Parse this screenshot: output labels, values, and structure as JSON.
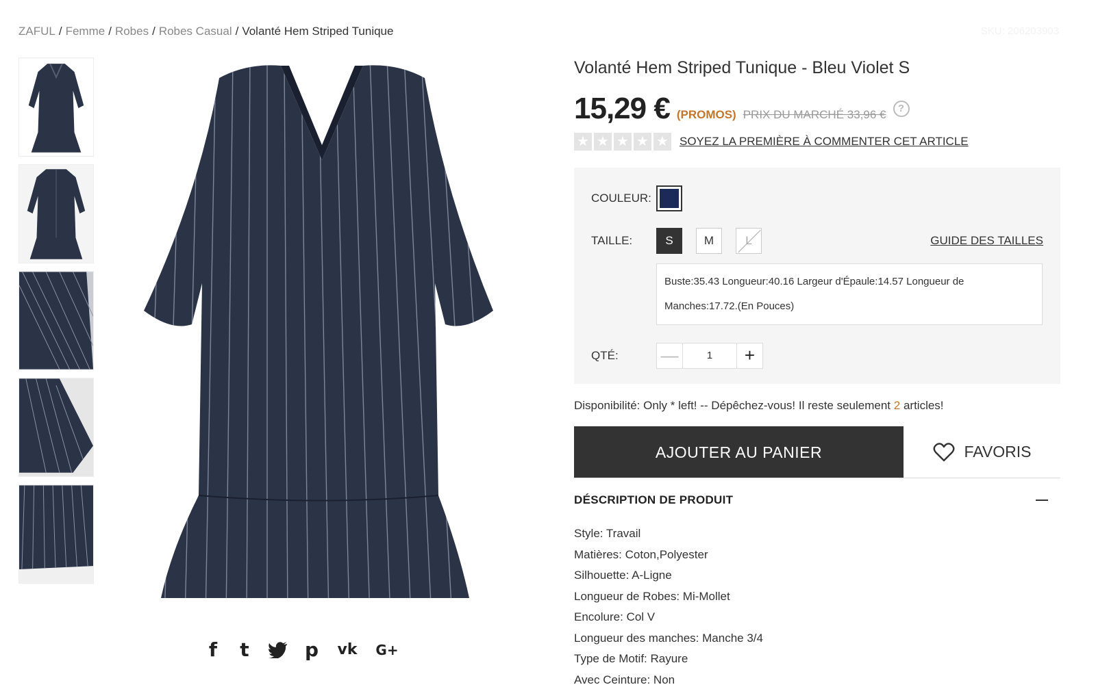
{
  "breadcrumb": {
    "items": [
      "ZAFUL",
      "Femme",
      "Robes",
      "Robes Casual"
    ],
    "current": "Volanté Hem Striped Tunique",
    "separator": "/"
  },
  "sku": "SKU: 206203903",
  "gallery": {
    "thumbnails": [
      "front-view",
      "back-view",
      "fabric-detail",
      "sleeve-detail",
      "hem-detail"
    ],
    "main_image": "striped-dress-front",
    "dress_color": "#2b3347"
  },
  "share": {
    "networks": [
      "facebook-icon",
      "tumblr-icon",
      "twitter-icon",
      "pinterest-icon",
      "vk-icon",
      "google-plus-icon"
    ],
    "facebook_glyph": "f",
    "tumblr_glyph": "t",
    "pinterest_glyph": "p",
    "vk_glyph": "vk",
    "googleplus_glyph": "G+"
  },
  "product": {
    "title": "Volanté Hem Striped Tunique - Bleu Violet S",
    "price": "15,29 €",
    "promo": "(PROMOS)",
    "market_price": "PRIX DU MARCHÉ 33,96 €",
    "help_glyph": "?",
    "rating": 0,
    "star_glyph": "★",
    "review_link": "SOYEZ LA PREMIÈRE À COMMENTER CET ARTICLE"
  },
  "options": {
    "color_label": "COULEUR:",
    "color_value": "#1c2a5a",
    "size_label": "TAILLE:",
    "sizes": [
      "S",
      "M",
      "L"
    ],
    "selected_size": "S",
    "unavailable_size": "L",
    "size_guide": "GUIDE DES TAILLES",
    "measurements": "Buste:35.43   Longueur:40.16   Largeur d'Épaule:14.57   Longueur de Manches:17.72.(En Pouces)",
    "qty_label": "QTÉ:",
    "qty_value": "1",
    "minus": "—",
    "plus": "+"
  },
  "availability": {
    "prefix": "Disponibilité: Only * left! -- Dépêchez-vous! Il reste seulement ",
    "count": "2",
    "suffix": " articles!"
  },
  "actions": {
    "add_to_cart": "AJOUTER AU PANIER",
    "favorites": "FAVORIS"
  },
  "description": {
    "title": "DÉSCRIPTION DE PRODUIT",
    "items": [
      "Style: Travail",
      "Matières: Coton,Polyester",
      "Silhouette: A-Ligne",
      "Longueur de Robes: Mi-Mollet",
      "Encolure: Col V",
      "Longueur des manches: Manche 3/4",
      "Type de Motif: Rayure",
      "Avec Ceinture: Non"
    ]
  }
}
